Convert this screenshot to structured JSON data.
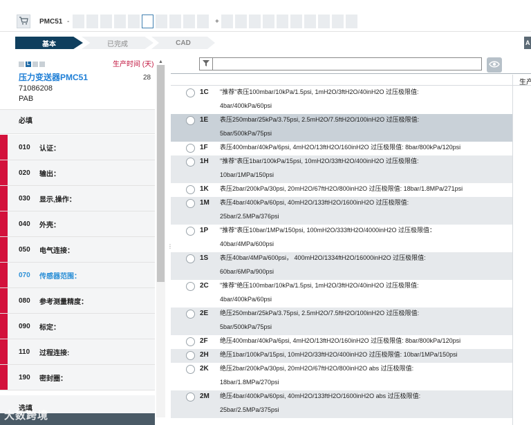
{
  "header": {
    "product_code": "PMC51",
    "dash": "-",
    "plus": "+",
    "slots_left_count_note": "",
    "cart_icon": "cart-icon"
  },
  "tabs": [
    {
      "label": "基本",
      "state": "active"
    },
    {
      "label": "已完成",
      "state": "inactive"
    },
    {
      "label": "CAD",
      "state": "inactive"
    }
  ],
  "tab_right_label": "A",
  "product": {
    "badge_letter": "L",
    "title": "压力变送器PMC51",
    "order_id": "71086208",
    "pab": "PAB",
    "production_time_label": "生产时间 (天)",
    "production_time_value": "28"
  },
  "sections": {
    "required": "必填",
    "optional": "选填"
  },
  "nav": [
    {
      "num": "010",
      "label": "认证："
    },
    {
      "num": "020",
      "label": "输出："
    },
    {
      "num": "030",
      "label": "显示,操作："
    },
    {
      "num": "040",
      "label": "外壳："
    },
    {
      "num": "050",
      "label": "电气连接："
    },
    {
      "num": "070",
      "label": "传感器范围：",
      "active": true
    },
    {
      "num": "080",
      "label": "参考测量精度："
    },
    {
      "num": "090",
      "label": "标定："
    },
    {
      "num": "110",
      "label": "过程连接:"
    },
    {
      "num": "190",
      "label": "密封圈："
    }
  ],
  "table": {
    "column_header": "生产",
    "filter_value": ""
  },
  "options": [
    {
      "code": "1C",
      "lines": [
        "\"推荐\"表压100mbar/10kPa/1.5psi, 1mH2O/3ftH2O/40inH2O 过压极限值:",
        "4bar/400kPa/60psi"
      ]
    },
    {
      "code": "1E",
      "lines": [
        "表压250mbar/25kPa/3.75psi, 2.5mH2O/7.5ftH2O/100inH2O 过压极限值:",
        "5bar/500kPa/75psi"
      ],
      "selected": true
    },
    {
      "code": "1F",
      "lines": [
        "表压400mbar/40kPa/6psi, 4mH2O/13ftH2O/160inH2O 过压极限值: 8bar/800kPa/120psi"
      ]
    },
    {
      "code": "1H",
      "lines": [
        "\"推荐\"表压1bar/100kPa/15psi, 10mH2O/33ftH2O/400inH2O 过压极限值:",
        "10bar/1MPa/150psi"
      ]
    },
    {
      "code": "1K",
      "lines": [
        "表压2bar/200kPa/30psi, 20mH2O/67ftH2O/800inH2O 过压极限值: 18bar/1.8MPa/271psi"
      ]
    },
    {
      "code": "1M",
      "lines": [
        "表压4bar/400kPa/60psi, 40mH2O/133ftH2O/1600inH2O 过压极限值:",
        "25bar/2.5MPa/376psi"
      ]
    },
    {
      "code": "1P",
      "lines": [
        "\"推荐\"表压10bar/1MPa/150psi, 100mH2O/333ftH2O/4000inH2O 过压极限值：",
        "40bar/4MPa/600psi"
      ]
    },
    {
      "code": "1S",
      "lines": [
        "表压40bar/4MPa/600psi， 400mH2O/1334ftH2O/16000inH2O 过压极限值:",
        "60bar/6MPa/900psi"
      ]
    },
    {
      "code": "2C",
      "lines": [
        "\"推荐\"绝压100mbar/10kPa/1.5psi, 1mH2O/3ftH2O/40inH2O 过压极限值:",
        "4bar/400kPa/60psi"
      ]
    },
    {
      "code": "2E",
      "lines": [
        "绝压250mbar/25kPa/3.75psi, 2.5mH2O/7.5ftH2O/100inH2O 过压极限值:",
        "5bar/500kPa/75psi"
      ]
    },
    {
      "code": "2F",
      "lines": [
        "绝压400mbar/40kPa/6psi, 4mH2O/13ftH2O/160inH2O 过压极限值: 8bar/800kPa/120psi"
      ]
    },
    {
      "code": "2H",
      "lines": [
        "绝压1bar/100kPa/15psi, 10mH2O/33ftH2O/400inH2O 过压极限值: 10bar/1MPa/150psi"
      ]
    },
    {
      "code": "2K",
      "lines": [
        "绝压2bar/200kPa/30psi, 20mH2O/67ftH2O/800inH2O abs 过压极限值:",
        "18bar/1.8MPa/270psi"
      ]
    },
    {
      "code": "2M",
      "lines": [
        "绝压4bar/400kPa/60psi, 40mH2O/133ftH2O/1600inH2O abs 过压极限值:",
        "25bar/2.5MPa/375psi"
      ]
    }
  ],
  "watermark": "大数跨境",
  "colors": {
    "accent_blue": "#1f7fd6",
    "active_tab": "#0f3f5e",
    "required_bar": "#d3123c",
    "selected_row": "#c9d1d8",
    "shaded_row": "#e6e9ec"
  }
}
